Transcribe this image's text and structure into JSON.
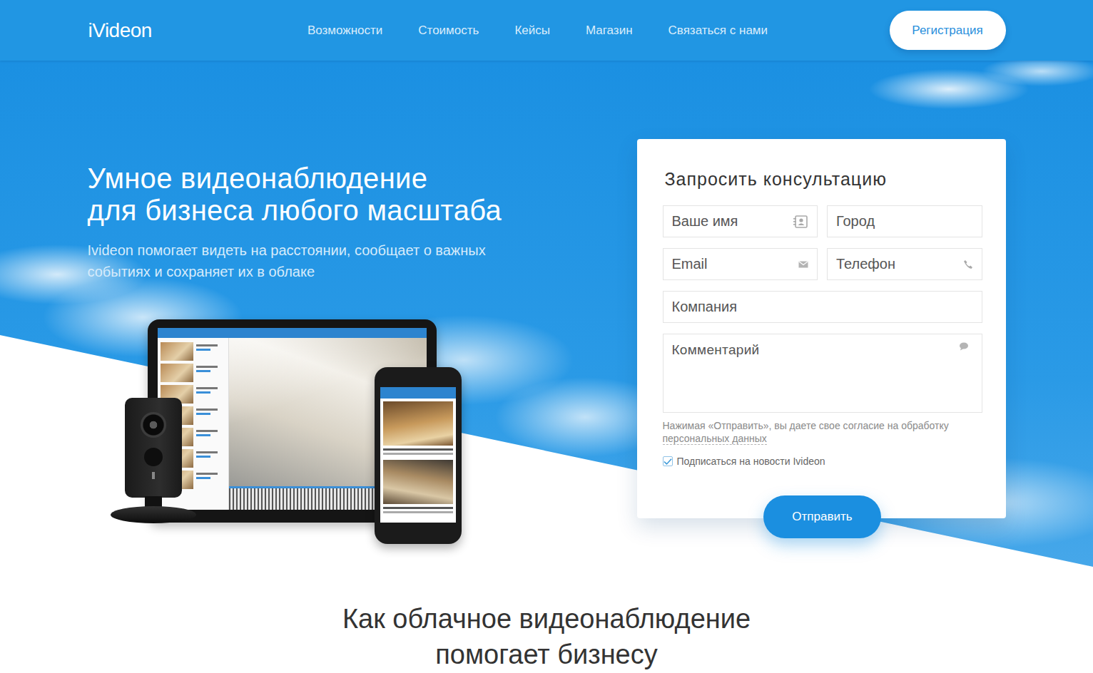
{
  "header": {
    "logo": "iVideon",
    "nav": [
      {
        "label": "Возможности"
      },
      {
        "label": "Стоимость"
      },
      {
        "label": "Кейсы"
      },
      {
        "label": "Магазин"
      },
      {
        "label": "Связаться с нами"
      }
    ],
    "register_button": "Регистрация"
  },
  "hero": {
    "title_lines": [
      "Умное видеонаблюдение",
      "для бизнеса любого масштаба"
    ],
    "subtitle_lines": [
      "Ivideon помогает видеть на расстоянии, сообщает о важных",
      "событиях и сохраняет их в облаке"
    ]
  },
  "form": {
    "title": "Запросить консультацию",
    "name": {
      "placeholder": "Ваше имя"
    },
    "city": {
      "placeholder": "Город"
    },
    "email": {
      "placeholder": "Email"
    },
    "phone": {
      "placeholder": "Телефон"
    },
    "company": {
      "placeholder": "Компания"
    },
    "comment": {
      "placeholder": "Комментарий"
    },
    "consent_text": "Нажимая «Отправить», вы даете свое согласие на обработку",
    "consent_link": "персональных данных",
    "subscribe": {
      "label": "Подписаться на новости Ivideon",
      "checked": true
    },
    "submit_button": "Отправить"
  },
  "features": {
    "title_lines": [
      "Как облачное видеонаблюдение",
      "помогает бизнесу"
    ]
  }
}
